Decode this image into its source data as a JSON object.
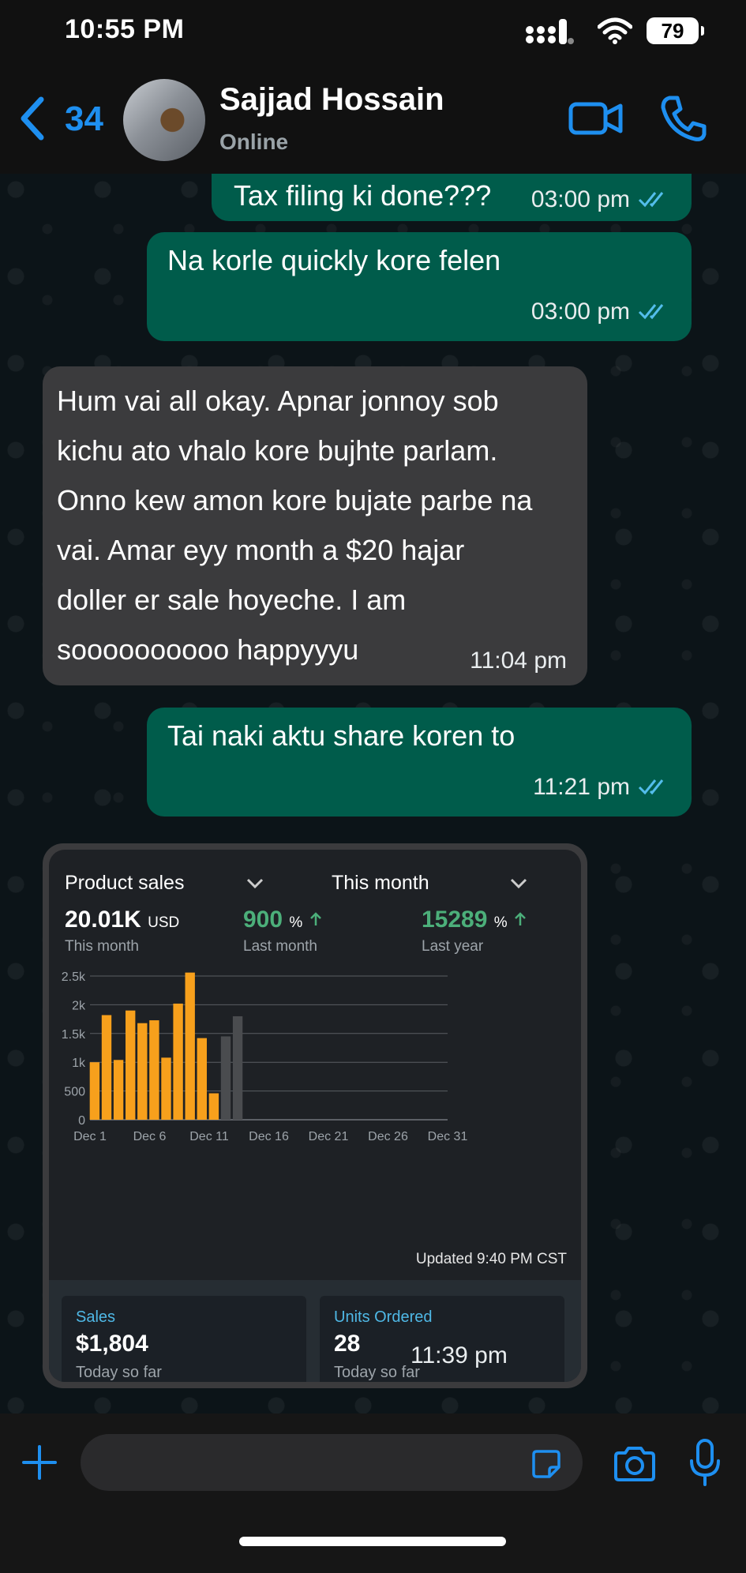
{
  "status_bar": {
    "time": "10:55 PM",
    "battery": "79"
  },
  "header": {
    "back_count": "34",
    "contact_name": "Sajjad Hossain",
    "contact_status": "Online"
  },
  "messages": [
    {
      "direction": "out",
      "text": "Tax filing ki done???",
      "time": "03:00 pm",
      "read": true
    },
    {
      "direction": "out",
      "text": "Na korle quickly kore felen",
      "time": "03:00 pm",
      "read": true
    },
    {
      "direction": "in",
      "lines": [
        " Hum vai all okay. Apnar jonnoy sob",
        "kichu ato vhalo kore bujhte parlam.",
        "Onno kew amon kore bujate parbe na",
        "vai. Amar eyy month a $20 hajar",
        "doller er sale hoyeche. I am",
        "soooooooooo happyyyu"
      ],
      "time": "11:04 pm"
    },
    {
      "direction": "out",
      "text": "Tai naki aktu share koren to",
      "time": "11:21 pm",
      "read": true
    },
    {
      "direction": "in",
      "type": "image",
      "time": "11:39 pm"
    }
  ],
  "screenshot": {
    "dropdown_metric": "Product sales",
    "dropdown_period": "This month",
    "kpis": [
      {
        "value": "20.01K",
        "unit": "USD",
        "label": "This month"
      },
      {
        "value": "900",
        "unit": "%",
        "label": "Last month"
      },
      {
        "value": "15289",
        "unit": "%",
        "label": "Last year"
      }
    ],
    "updated": "Updated 9:40 PM CST",
    "cards": [
      {
        "label": "Sales",
        "value": "$1,804",
        "sub": "Today so far"
      },
      {
        "label": "Units Ordered",
        "value": "28",
        "sub": "Today so far"
      }
    ]
  },
  "chart_data": {
    "type": "bar",
    "x": [
      1,
      2,
      3,
      4,
      5,
      6,
      7,
      8,
      9,
      10,
      11,
      12,
      13
    ],
    "values": [
      1000,
      1820,
      1040,
      1900,
      1680,
      1730,
      1080,
      2020,
      2560,
      1420,
      460,
      1450,
      1800
    ],
    "series_colors": [
      "#f7a01c",
      "#f7a01c",
      "#f7a01c",
      "#f7a01c",
      "#f7a01c",
      "#f7a01c",
      "#f7a01c",
      "#f7a01c",
      "#f7a01c",
      "#f7a01c",
      "#f7a01c",
      "#4a4c4f",
      "#4a4c4f"
    ],
    "yticks": [
      "0",
      "500",
      "1k",
      "1.5k",
      "2k",
      "2.5k"
    ],
    "ytick_values": [
      0,
      500,
      1000,
      1500,
      2000,
      2500
    ],
    "xticks": [
      "Dec 1",
      "Dec 6",
      "Dec 11",
      "Dec 16",
      "Dec 21",
      "Dec 26",
      "Dec 31"
    ],
    "xtick_values": [
      1,
      6,
      11,
      16,
      21,
      26,
      31
    ],
    "xlim": [
      1,
      31
    ],
    "ylim": [
      0,
      2500
    ],
    "grid": true
  },
  "colors": {
    "accent": "#1e8ff0",
    "outgoing": "#005c4b",
    "incoming": "#3b3b3d",
    "bar": "#f7a01c",
    "tick": "#53bdeb"
  }
}
